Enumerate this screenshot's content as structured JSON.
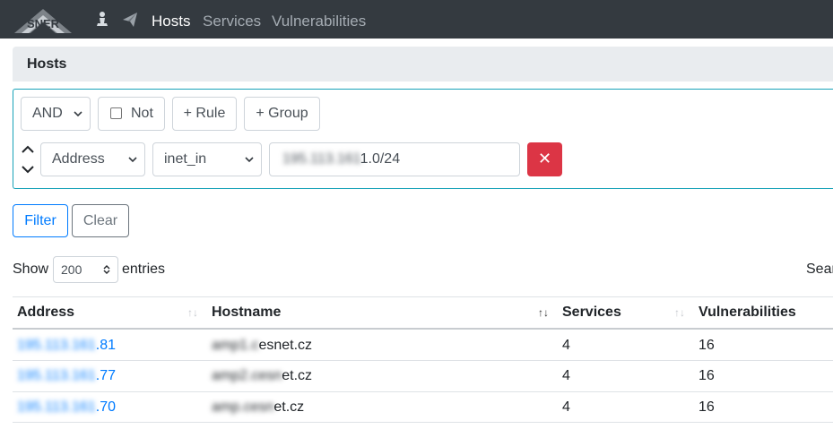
{
  "navbar": {
    "brand_text": "SNER",
    "icons": [
      "user-icon",
      "paper-plane-icon"
    ],
    "links": [
      {
        "label": "Hosts",
        "active": true
      },
      {
        "label": "Services",
        "active": false
      },
      {
        "label": "Vulnerabilities",
        "active": false
      }
    ]
  },
  "card": {
    "title": "Hosts"
  },
  "query_builder": {
    "condition": "AND",
    "not_label": "Not",
    "not_checked": false,
    "add_rule_label": "+ Rule",
    "add_group_label": "+ Group",
    "rule": {
      "field": "Address",
      "operator": "inet_in",
      "value_hidden": "195.113.161",
      "value_suffix": "1.0/24",
      "delete_label": "✕"
    }
  },
  "actions": {
    "filter_label": "Filter",
    "clear_label": "Clear"
  },
  "length": {
    "show_label": "Show",
    "value": "200",
    "entries_label": "entries"
  },
  "search": {
    "label": "Search"
  },
  "table": {
    "columns": [
      {
        "label": "Address",
        "sort": "none"
      },
      {
        "label": "Hostname",
        "sort": "asc"
      },
      {
        "label": "Services",
        "sort": "none"
      },
      {
        "label": "Vulnerabilities",
        "sort": "none"
      }
    ],
    "rows": [
      {
        "address_hidden": "195.113.161",
        "address_suffix": ".81",
        "hostname_hidden": "amp1.c",
        "hostname_suffix": "esnet.cz",
        "services": "4",
        "vulnerabilities": "16"
      },
      {
        "address_hidden": "195.113.161",
        "address_suffix": ".77",
        "hostname_hidden": "amp2.cesn",
        "hostname_suffix": "et.cz",
        "services": "4",
        "vulnerabilities": "16"
      },
      {
        "address_hidden": "195.113.161",
        "address_suffix": ".70",
        "hostname_hidden": "amp.cesn",
        "hostname_suffix": "et.cz",
        "services": "4",
        "vulnerabilities": "16"
      }
    ]
  }
}
